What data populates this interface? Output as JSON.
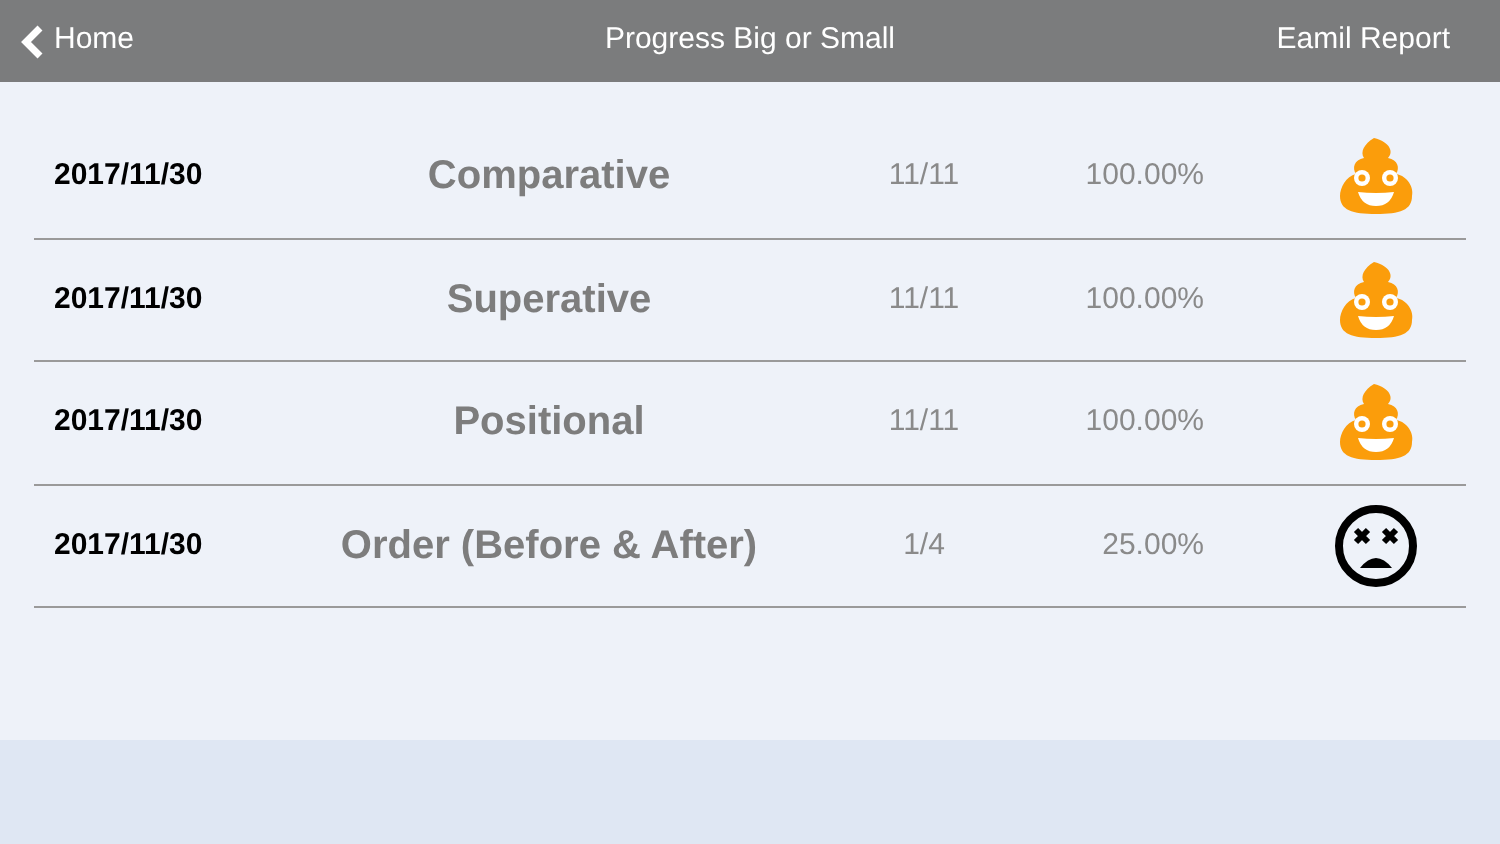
{
  "nav_bar": {
    "back": "Home",
    "title": "Progress Big or Small",
    "action": "Eamil Report"
  },
  "rows": [
    {
      "date": "2017/11/30",
      "name": "Comparative",
      "score": "11/11",
      "percent": "100.00%",
      "kind": "pass"
    },
    {
      "date": "2017/11/30",
      "name": "Superative",
      "score": "11/11",
      "percent": "100.00%",
      "kind": "pass"
    },
    {
      "date": "2017/11/30",
      "name": "Positional",
      "score": "11/11",
      "percent": "100.00%",
      "kind": "pass"
    },
    {
      "date": "2017/11/30",
      "name": "Order (Before & After)",
      "score": "1/4",
      "percent": "25.00%",
      "kind": "fail"
    }
  ]
}
